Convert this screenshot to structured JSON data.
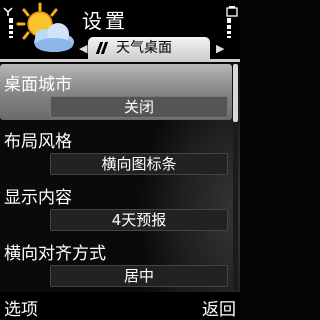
{
  "header": {
    "title": "设置",
    "tab_label": "天气桌面",
    "left_arrow": "◀",
    "right_arrow": "▶"
  },
  "settings": [
    {
      "label": "桌面城市",
      "value": "关闭",
      "selected": true
    },
    {
      "label": "布局风格",
      "value": "横向图标条",
      "selected": false
    },
    {
      "label": "显示内容",
      "value": "4天预报",
      "selected": false
    },
    {
      "label": "横向对齐方式",
      "value": "居中",
      "selected": false
    }
  ],
  "softkeys": {
    "left": "选项",
    "right": "返回"
  },
  "icons": {
    "weather": "sun-cloud-icon",
    "signal": "signal-icon",
    "battery": "battery-icon"
  }
}
